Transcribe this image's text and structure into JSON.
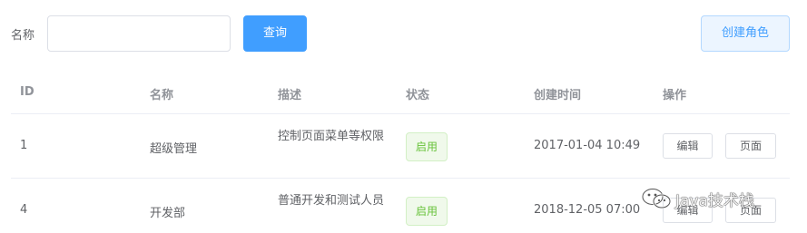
{
  "search": {
    "label": "名称",
    "input_value": "",
    "query_label": "查询",
    "create_label": "创建角色"
  },
  "table": {
    "headers": [
      "ID",
      "名称",
      "描述",
      "状态",
      "创建时间",
      "操作"
    ],
    "rows": [
      {
        "id": "1",
        "name": "超级管理",
        "description": "控制页面菜单等权限",
        "status": "启用",
        "created": "2017-01-04 10:49",
        "edit": "编辑",
        "page": "页面"
      },
      {
        "id": "4",
        "name": "开发部",
        "description": "普通开发和测试人员",
        "status": "启用",
        "created": "2018-12-05 07:00",
        "edit": "编辑",
        "page": "页面"
      }
    ]
  },
  "watermark": {
    "text": "Java技术栈",
    "icon": "wechat-icon"
  },
  "colors": {
    "primary": "#409eff",
    "success": "#67c23a",
    "header_text": "#909399",
    "body_text": "#606266",
    "border": "#ebeef5"
  }
}
